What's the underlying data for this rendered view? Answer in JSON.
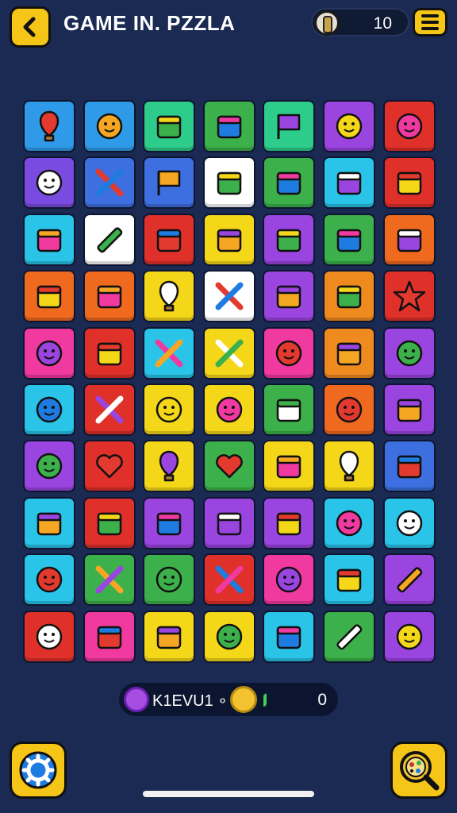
{
  "header": {
    "title": "GAME IN. PZZLA",
    "coins": "10",
    "back_icon": "chevron-left-icon",
    "menu_icon": "hamburger-menu-icon",
    "coin_icon": "coin-icon"
  },
  "board": {
    "rows": [
      [
        {
          "name": "hot-air-balloon-icon",
          "bg": "#2f9be8"
        },
        {
          "name": "blob-face-icon",
          "bg": "#2f9be8"
        },
        {
          "name": "red-lips-icon",
          "bg": "#2ecc8a"
        },
        {
          "name": "radio-icon",
          "bg": "#3cb04a"
        },
        {
          "name": "flag-icon",
          "bg": "#2ecc8a"
        },
        {
          "name": "sun-face-icon",
          "bg": "#9a45e0"
        },
        {
          "name": "camera-face-icon",
          "bg": "#e0302a"
        }
      ],
      [
        {
          "name": "ring-face-icon",
          "bg": "#7a4be0"
        },
        {
          "name": "scissors-icon",
          "bg": "#3e6fe0"
        },
        {
          "name": "yellow-flag-icon",
          "bg": "#3e6fe0"
        },
        {
          "name": "shoe-icon",
          "bg": "#ffffff"
        },
        {
          "name": "calendar-icon",
          "bg": "#3cb04a"
        },
        {
          "name": "bag-icon",
          "bg": "#29c4e8"
        },
        {
          "name": "blue-box-icon",
          "bg": "#e0302a"
        }
      ],
      [
        {
          "name": "paper-plane-icon",
          "bg": "#29c4e8"
        },
        {
          "name": "pencil-icon",
          "bg": "#ffffff"
        },
        {
          "name": "chart-icon",
          "bg": "#e0302a"
        },
        {
          "name": "frame-icon",
          "bg": "#f5d71a"
        },
        {
          "name": "map-icon",
          "bg": "#9a45e0"
        },
        {
          "name": "red-wallet-icon",
          "bg": "#3cb04a"
        },
        {
          "name": "red-card-icon",
          "bg": "#ef6a1f"
        }
      ],
      [
        {
          "name": "jar-icon",
          "bg": "#ef6a1f"
        },
        {
          "name": "basket-icon",
          "bg": "#ef6a1f"
        },
        {
          "name": "lightbulb-icon",
          "bg": "#f5d71a"
        },
        {
          "name": "rainbow-icon",
          "bg": "#ffffff"
        },
        {
          "name": "cake-icon",
          "bg": "#9a45e0"
        },
        {
          "name": "splat-icon",
          "bg": "#ef8a1f"
        },
        {
          "name": "star-icon",
          "bg": "#e0302a"
        }
      ],
      [
        {
          "name": "smiley-blob-icon",
          "bg": "#f03aa0"
        },
        {
          "name": "envelope-icon",
          "bg": "#e0302a"
        },
        {
          "name": "crossed-tools-icon",
          "bg": "#29c4e8"
        },
        {
          "name": "gift-bow-icon",
          "bg": "#f5d71a"
        },
        {
          "name": "smiley-sun-icon",
          "bg": "#f03aa0"
        },
        {
          "name": "shield-icon",
          "bg": "#ef8a1f"
        },
        {
          "name": "round-face-icon",
          "bg": "#9a45e0"
        }
      ],
      [
        {
          "name": "happy-flower-icon",
          "bg": "#29c4e8"
        },
        {
          "name": "x-bandage-icon",
          "bg": "#e0302a"
        },
        {
          "name": "green-gear-face-icon",
          "bg": "#f5d71a"
        },
        {
          "name": "red-gear-face-icon",
          "bg": "#f5d71a"
        },
        {
          "name": "green-bag-icon",
          "bg": "#3cb04a"
        },
        {
          "name": "purple-flower-icon",
          "bg": "#ef6a1f"
        },
        {
          "name": "toast-icon",
          "bg": "#9a45e0"
        }
      ],
      [
        {
          "name": "purple-gear-face-icon",
          "bg": "#9a45e0"
        },
        {
          "name": "heart-tag-icon",
          "bg": "#e0302a"
        },
        {
          "name": "map-pin-icon",
          "bg": "#f5d71a"
        },
        {
          "name": "heart-icon",
          "bg": "#3cb04a"
        },
        {
          "name": "spade-icon",
          "bg": "#f5d71a"
        },
        {
          "name": "shopping-bag-icon",
          "bg": "#f5d71a"
        },
        {
          "name": "striped-card-icon",
          "bg": "#3e6fe0"
        }
      ],
      [
        {
          "name": "trash-can-icon",
          "bg": "#29c4e8"
        },
        {
          "name": "lunch-box-icon",
          "bg": "#e0302a"
        },
        {
          "name": "rose-icon",
          "bg": "#9a45e0"
        },
        {
          "name": "no-leaf-icon",
          "bg": "#9a45e0"
        },
        {
          "name": "gift-box-icon",
          "bg": "#9a45e0"
        },
        {
          "name": "droplet-face-icon",
          "bg": "#29c4e8"
        },
        {
          "name": "cloud-face-icon",
          "bg": "#29c4e8"
        }
      ],
      [
        {
          "name": "diamond-face-icon",
          "bg": "#29c4e8"
        },
        {
          "name": "red-bow-icon",
          "bg": "#3cb04a"
        },
        {
          "name": "flower-bulb-icon",
          "bg": "#3cb04a"
        },
        {
          "name": "pickaxe-icon",
          "bg": "#e0302a"
        },
        {
          "name": "ghost-face-icon",
          "bg": "#f03aa0"
        },
        {
          "name": "eye-icon",
          "bg": "#29c4e8"
        },
        {
          "name": "pin-needle-icon",
          "bg": "#9a45e0"
        }
      ],
      [
        {
          "name": "hat-face-icon",
          "bg": "#e0302a"
        },
        {
          "name": "hat-icon",
          "bg": "#f03aa0"
        },
        {
          "name": "speech-bubble-icon",
          "bg": "#f5d71a"
        },
        {
          "name": "lion-face-icon",
          "bg": "#f5d71a"
        },
        {
          "name": "leaf-icon",
          "bg": "#29c4e8"
        },
        {
          "name": "ruler-icon",
          "bg": "#3cb04a"
        },
        {
          "name": "bread-face-icon",
          "bg": "#9a45e0"
        }
      ]
    ]
  },
  "status": {
    "label": "K1EVU1 ∘",
    "value": "0",
    "orb_icon": "purple-orb-icon",
    "coin_icon": "gold-coin-icon"
  },
  "footer": {
    "settings_icon": "settings-gear-icon",
    "hint_icon": "magnifier-hint-icon"
  }
}
